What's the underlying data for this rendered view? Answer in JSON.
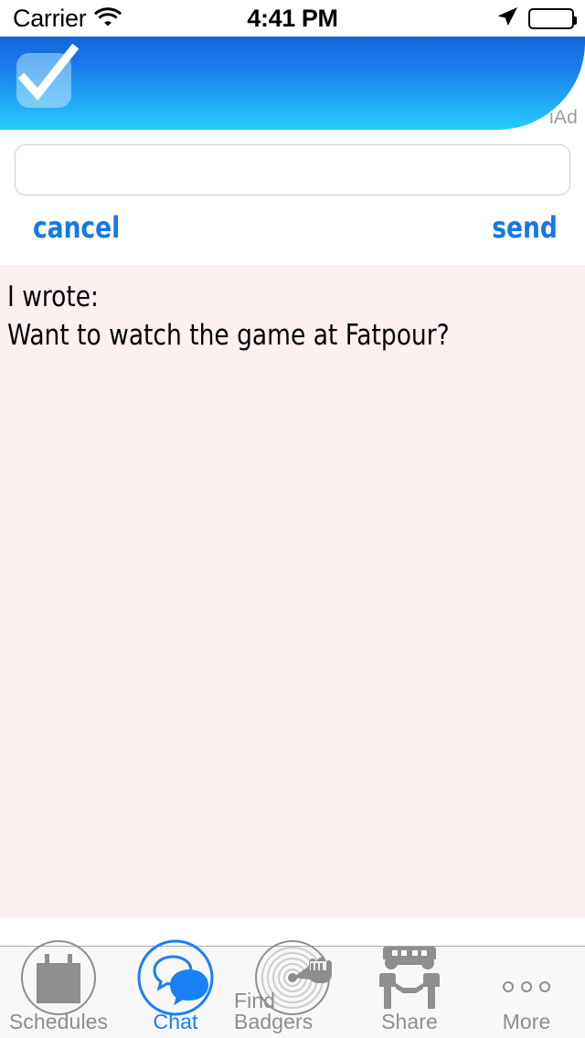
{
  "status_bar": {
    "carrier": "Carrier",
    "wifi_icon": "wifi-icon",
    "time": "4:41 PM",
    "location_icon": "location-arrow-icon",
    "battery_icon": "battery-full-icon"
  },
  "ad_banner": {
    "label": "iAd",
    "icon": "checkmark-icon",
    "gradient_top": "#1266d8",
    "gradient_bottom": "#26cbfb"
  },
  "compose": {
    "input_value": "",
    "input_placeholder": "",
    "cancel_label": "cancel",
    "send_label": "send",
    "link_color": "#1478e8"
  },
  "content": {
    "background_color": "#fdf0f1",
    "messages": [
      {
        "prefix": "I wrote:",
        "body": "Want to watch the game at Fatpour?",
        "text": "I wrote:\nWant to watch the game at Fatpour?"
      }
    ]
  },
  "tabbar": {
    "background_color": "#f7f7f7",
    "selected_color": "#1a80f5",
    "inactive_color": "#8e8e8e",
    "items": [
      {
        "label": "Schedules",
        "icon": "calendar-icon",
        "selected": false
      },
      {
        "label": "Chat",
        "icon": "chat-bubbles-icon",
        "selected": true
      },
      {
        "label": "Find Badgers",
        "icon": "radar-hand-icon",
        "selected": false
      },
      {
        "label": "Share",
        "icon": "handshake-icon",
        "selected": false
      },
      {
        "label": "More",
        "icon": "ellipsis-icon",
        "selected": false
      }
    ]
  }
}
